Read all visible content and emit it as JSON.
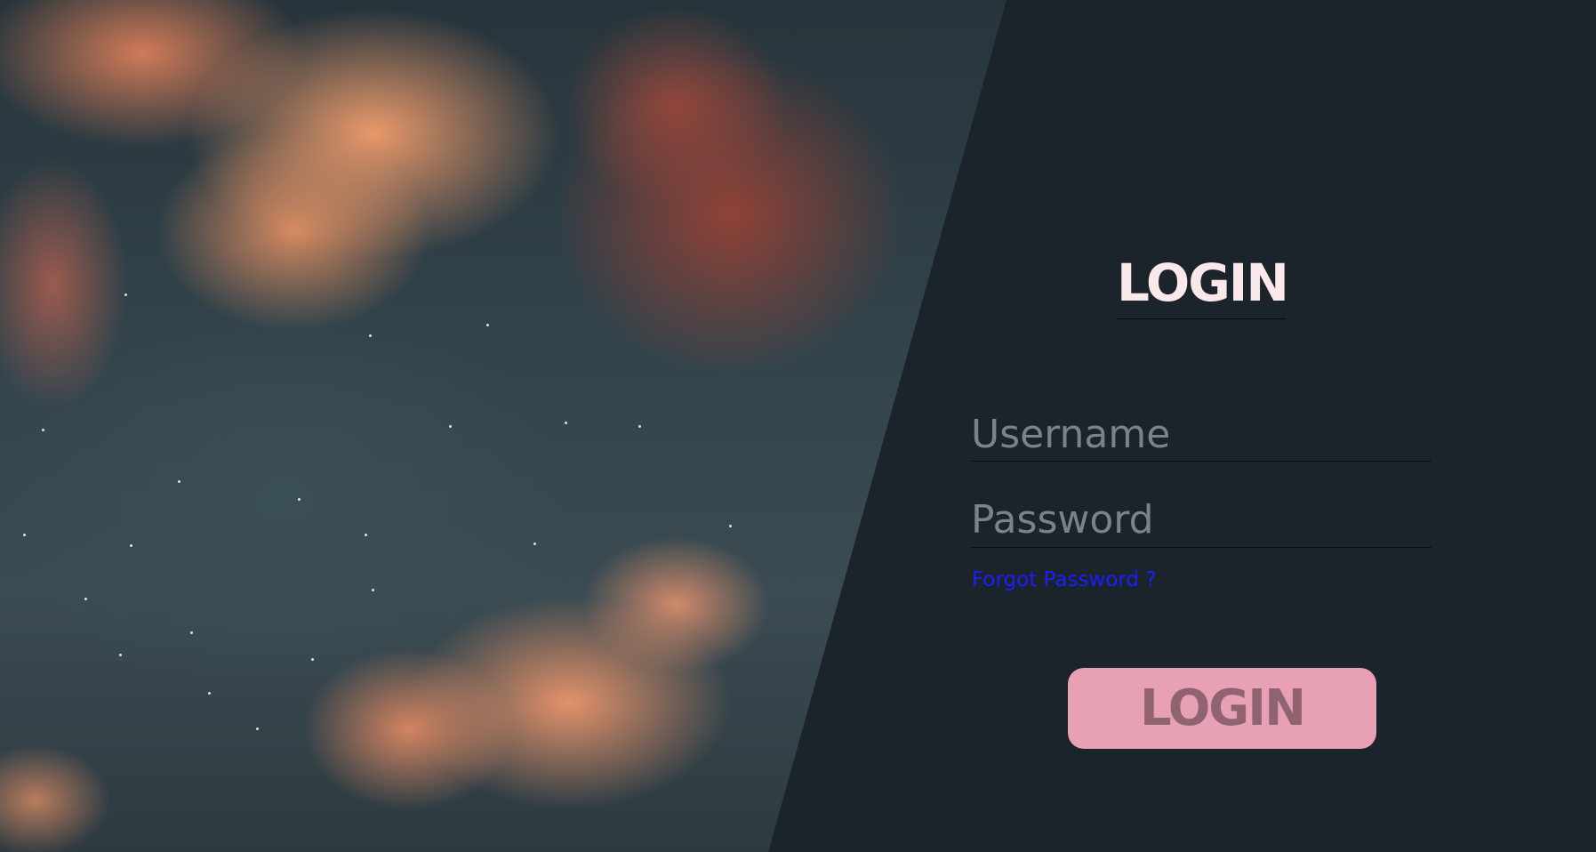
{
  "colors": {
    "panel_background": "#1c242b",
    "title_text": "#fbe8ea",
    "input_placeholder": "#7c8388",
    "forgot_link": "#1a1dff",
    "button_background": "#e8a1b4",
    "button_text": "#8f6470"
  },
  "background": {
    "description_icon": "cloudy-sunset-sky-image"
  },
  "login_form": {
    "title": "LOGIN",
    "username_placeholder": "Username",
    "username_value": "",
    "password_placeholder": "Password",
    "password_value": "",
    "forgot_password_label": "Forgot Password ?",
    "submit_label": "LOGIN"
  }
}
